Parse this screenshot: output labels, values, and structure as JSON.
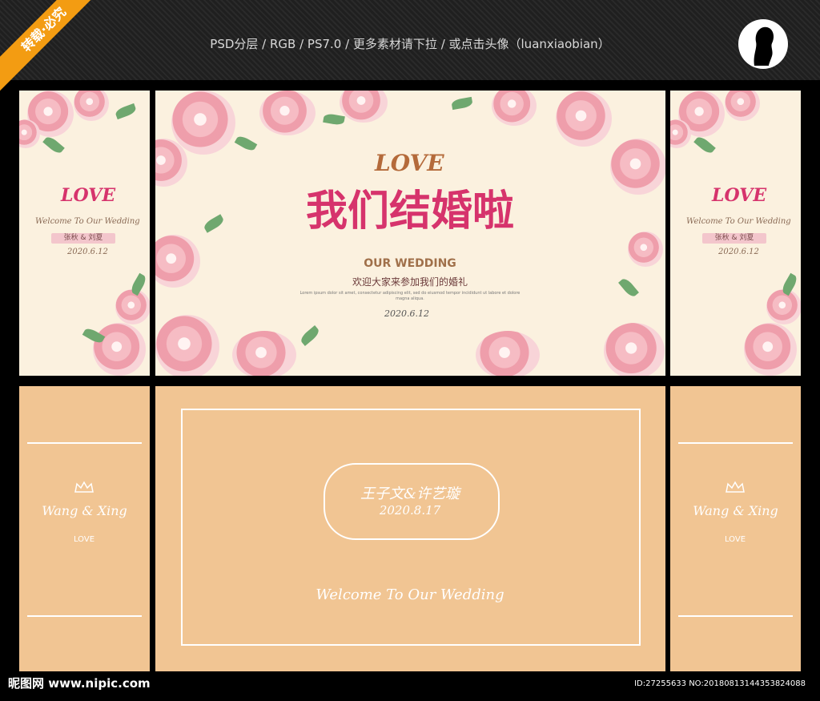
{
  "header": {
    "info": "PSD分层 / RGB / PS7.0 / 更多素材请下拉 / 或点击头像（luanxiaobian）",
    "ribbon": "转载·必究"
  },
  "top_center": {
    "love": "LOVE",
    "title": "我们结婚啦",
    "subtitle": "OUR WEDDING",
    "welcome": "欢迎大家来参加我们的婚礼",
    "lorem": "Lorem ipsum dolor sit amet, consectetur adipiscing elit, sed do eiusmod tempor incididunt ut labore et dolore magna aliqua.",
    "date": "2020.6.12"
  },
  "top_side": {
    "love": "LOVE",
    "welcome": "Welcome To Our Wedding",
    "names": "张秋 & 刘夏",
    "date": "2020.6.12"
  },
  "bottom_center": {
    "names": "王子文&许艺璇",
    "date": "2020.8.17",
    "welcome": "Welcome To Our Wedding"
  },
  "bottom_side": {
    "names": "Wang & Xing",
    "love": "LOVE"
  },
  "footer": {
    "logo": "昵图网 www.nipic.com",
    "id": "ID:27255633 NO:20180813144353824088"
  },
  "colors": {
    "accent": "#d6336c",
    "cream": "#fbf1df",
    "peach": "#f1c593"
  },
  "icons": [
    "crown-icon",
    "avatar-icon",
    "rose-icon"
  ]
}
